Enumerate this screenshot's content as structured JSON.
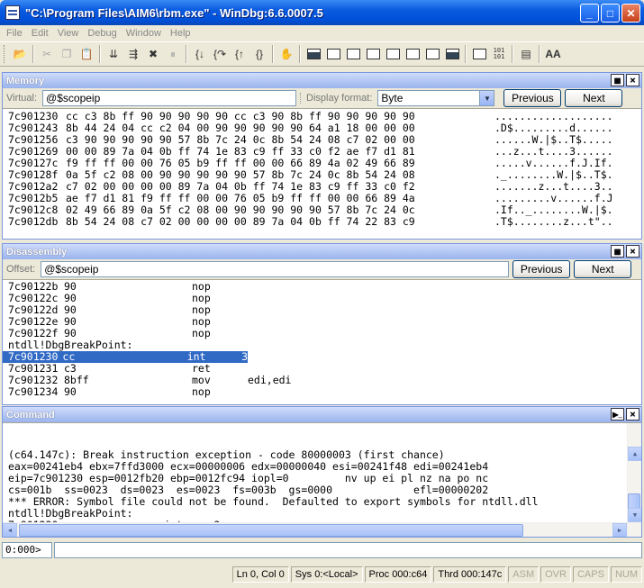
{
  "window": {
    "title": "\"C:\\Program Files\\AIM6\\rbm.exe\" - WinDbg:6.6.0007.5",
    "minimize": "_",
    "maximize": "□",
    "close": "✕"
  },
  "menu": [
    "File",
    "Edit",
    "View",
    "Debug",
    "Window",
    "Help"
  ],
  "toolbar": {
    "icons": [
      "open-icon",
      "cut-icon",
      "copy-icon",
      "paste-icon",
      "go-icon",
      "restart-icon",
      "stop-icon",
      "break-icon",
      "step-into-icon",
      "step-over-icon",
      "step-out-icon",
      "run-to-cursor-icon",
      "hand-icon",
      "command-window-icon",
      "watch-icon",
      "locals-icon",
      "registers-icon",
      "memory-icon",
      "callstack-icon",
      "disassembly-icon",
      "scratch-icon",
      "source-mode-icon",
      "hex-mode-icon",
      "options-icon",
      "font-icon"
    ],
    "source_hex_label": "101\n101",
    "font_label": "AA"
  },
  "memory": {
    "title": "Memory",
    "virtual_label": "Virtual:",
    "virtual_value": "@$scopeip",
    "format_label": "Display format:",
    "format_value": "Byte",
    "previous": "Previous",
    "next": "Next",
    "rows": [
      {
        "addr": "7c901230",
        "bytes": "cc c3 8b ff 90 90 90 90 90 cc c3 90 8b ff 90 90 90 90 90",
        "ascii": "..................."
      },
      {
        "addr": "7c901243",
        "bytes": "8b 44 24 04 cc c2 04 00 90 90 90 90 90 64 a1 18 00 00 00",
        "ascii": ".D$.........d......"
      },
      {
        "addr": "7c901256",
        "bytes": "c3 90 90 90 90 90 57 8b 7c 24 0c 8b 54 24 08 c7 02 00 00",
        "ascii": "......W.|$..T$....."
      },
      {
        "addr": "7c901269",
        "bytes": "00 00 89 7a 04 0b ff 74 1e 83 c9 ff 33 c0 f2 ae f7 d1 81",
        "ascii": "...z...t....3......"
      },
      {
        "addr": "7c90127c",
        "bytes": "f9 ff ff 00 00 76 05 b9 ff ff 00 00 66 89 4a 02 49 66 89",
        "ascii": ".....v......f.J.If."
      },
      {
        "addr": "7c90128f",
        "bytes": "0a 5f c2 08 00 90 90 90 90 90 57 8b 7c 24 0c 8b 54 24 08",
        "ascii": "._........W.|$..T$."
      },
      {
        "addr": "7c9012a2",
        "bytes": "c7 02 00 00 00 00 89 7a 04 0b ff 74 1e 83 c9 ff 33 c0 f2",
        "ascii": ".......z...t....3.."
      },
      {
        "addr": "7c9012b5",
        "bytes": "ae f7 d1 81 f9 ff ff 00 00 76 05 b9 ff ff 00 00 66 89 4a",
        "ascii": ".........v......f.J"
      },
      {
        "addr": "7c9012c8",
        "bytes": "02 49 66 89 0a 5f c2 08 00 90 90 90 90 90 57 8b 7c 24 0c",
        "ascii": ".If.._........W.|$."
      },
      {
        "addr": "7c9012db",
        "bytes": "8b 54 24 08 c7 02 00 00 00 00 89 7a 04 0b ff 74 22 83 c9",
        "ascii": ".T$........z...t\".."
      }
    ]
  },
  "disassembly": {
    "title": "Disassembly",
    "offset_label": "Offset:",
    "offset_value": "@$scopeip",
    "previous": "Previous",
    "next": "Next",
    "rows": [
      {
        "addr": "7c90122b",
        "hex": "90",
        "mnemonic": "nop",
        "operands": "",
        "highlight": false
      },
      {
        "addr": "7c90122c",
        "hex": "90",
        "mnemonic": "nop",
        "operands": "",
        "highlight": false
      },
      {
        "addr": "7c90122d",
        "hex": "90",
        "mnemonic": "nop",
        "operands": "",
        "highlight": false
      },
      {
        "addr": "7c90122e",
        "hex": "90",
        "mnemonic": "nop",
        "operands": "",
        "highlight": false
      },
      {
        "addr": "7c90122f",
        "hex": "90",
        "mnemonic": "nop",
        "operands": "",
        "highlight": false
      },
      {
        "label": "ntdll!DbgBreakPoint:"
      },
      {
        "addr": "7c901230",
        "hex": "cc",
        "mnemonic": "int",
        "operands": "3",
        "highlight": true
      },
      {
        "addr": "7c901231",
        "hex": "c3",
        "mnemonic": "ret",
        "operands": "",
        "highlight": false
      },
      {
        "addr": "7c901232",
        "hex": "8bff",
        "mnemonic": "mov",
        "operands": "edi,edi",
        "highlight": false
      },
      {
        "addr": "7c901234",
        "hex": "90",
        "mnemonic": "nop",
        "operands": "",
        "highlight": false
      }
    ]
  },
  "command": {
    "title": "Command",
    "lines": [
      "(c64.147c): Break instruction exception - code 80000003 (first chance)",
      "eax=00241eb4 ebx=7ffd3000 ecx=00000006 edx=00000040 esi=00241f48 edi=00241eb4",
      "eip=7c901230 esp=0012fb20 ebp=0012fc94 iopl=0         nv up ei pl nz na po nc",
      "cs=001b  ss=0023  ds=0023  es=0023  fs=003b  gs=0000             efl=00000202",
      "*** ERROR: Symbol file could not be found.  Defaulted to export symbols for ntdll.dll",
      "ntdll!DbgBreakPoint:",
      "7c901230 cc              int     3"
    ],
    "prompt": "0:000>",
    "input_value": ""
  },
  "status": {
    "cells": [
      {
        "text": "Ln 0, Col 0",
        "enabled": true
      },
      {
        "text": "Sys 0:<Local>",
        "enabled": true
      },
      {
        "text": "Proc 000:c64",
        "enabled": true
      },
      {
        "text": "Thrd 000:147c",
        "enabled": true
      },
      {
        "text": "ASM",
        "enabled": false
      },
      {
        "text": "OVR",
        "enabled": false
      },
      {
        "text": "CAPS",
        "enabled": false
      },
      {
        "text": "NUM",
        "enabled": false
      }
    ]
  },
  "colors": {
    "selection": "#316ac5",
    "titlebar": "#0a5be0",
    "pane_title": "#9ab4ee"
  }
}
